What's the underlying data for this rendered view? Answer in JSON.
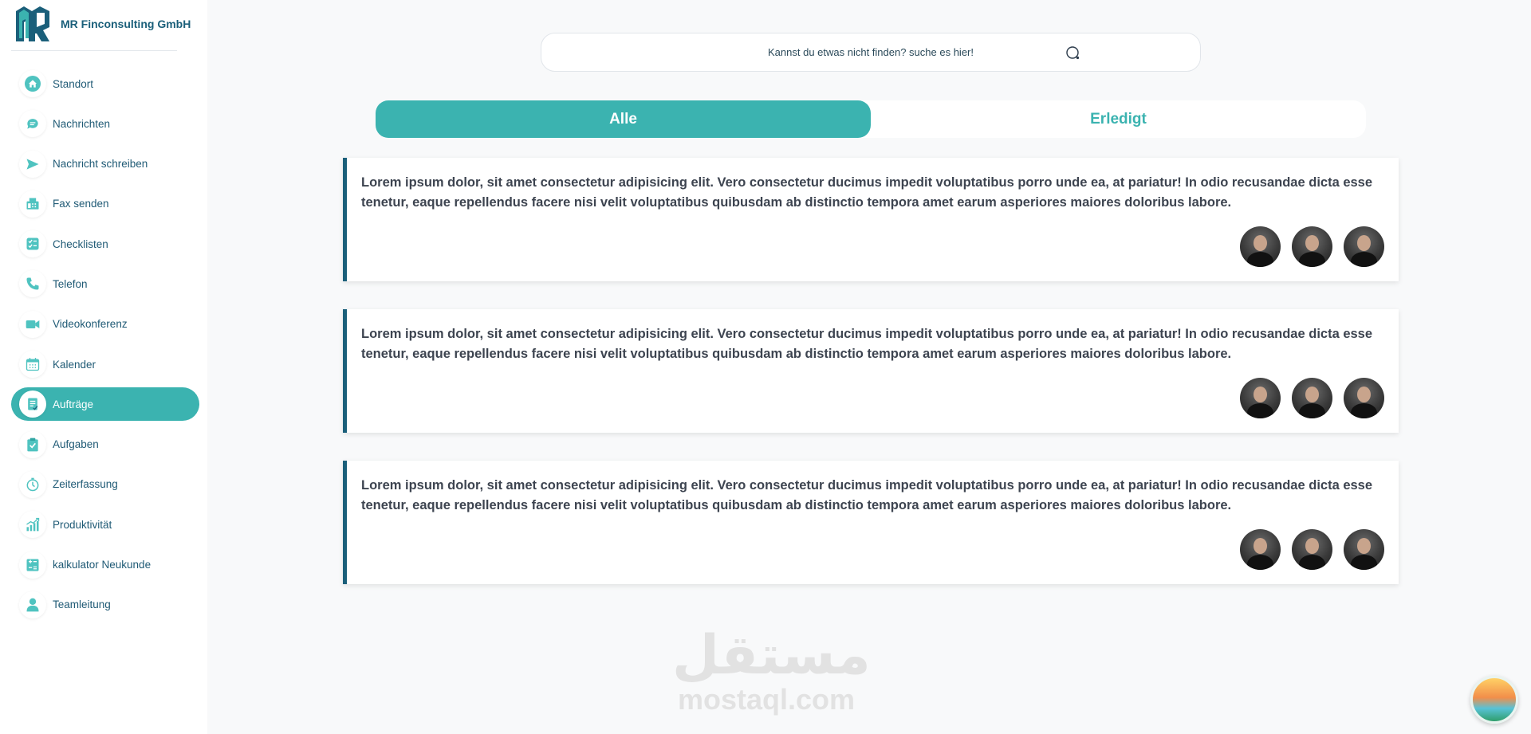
{
  "brand": {
    "name": "MR Finconsulting GmbH"
  },
  "nav": [
    {
      "label": "Standort",
      "icon": "home-icon"
    },
    {
      "label": "Nachrichten",
      "icon": "chat-icon"
    },
    {
      "label": "Nachricht schreiben",
      "icon": "send-icon"
    },
    {
      "label": "Fax senden",
      "icon": "fax-icon"
    },
    {
      "label": "Checklisten",
      "icon": "checklist-icon"
    },
    {
      "label": "Telefon",
      "icon": "phone-icon"
    },
    {
      "label": "Videokonferenz",
      "icon": "video-icon"
    },
    {
      "label": "Kalender",
      "icon": "calendar-icon"
    },
    {
      "label": "Aufträge",
      "icon": "orders-icon",
      "active": true
    },
    {
      "label": "Aufgaben",
      "icon": "clipboard-check-icon"
    },
    {
      "label": "Zeiterfassung",
      "icon": "stopwatch-icon"
    },
    {
      "label": "Produktivität",
      "icon": "chart-icon"
    },
    {
      "label": "kalkulator Neukunde",
      "icon": "calculator-icon"
    },
    {
      "label": "Teamleitung",
      "icon": "user-icon"
    }
  ],
  "search": {
    "placeholder": "Kannst du etwas nicht finden? suche es hier!"
  },
  "tabs": [
    {
      "label": "Alle",
      "active": true
    },
    {
      "label": "Erledigt",
      "active": false
    }
  ],
  "cards": [
    {
      "text": "Lorem ipsum dolor, sit amet consectetur adipisicing elit. Vero consectetur ducimus impedit voluptatibus porro unde ea, at pariatur! In odio recusandae dicta esse tenetur, eaque repellendus facere nisi velit voluptatibus quibusdam ab distinctio tempora amet earum asperiores maiores doloribus labore."
    },
    {
      "text": "Lorem ipsum dolor, sit amet consectetur adipisicing elit. Vero consectetur ducimus impedit voluptatibus porro unde ea, at pariatur! In odio recusandae dicta esse tenetur, eaque repellendus facere nisi velit voluptatibus quibusdam ab distinctio tempora amet earum asperiores maiores doloribus labore."
    },
    {
      "text": "Lorem ipsum dolor, sit amet consectetur adipisicing elit. Vero consectetur ducimus impedit voluptatibus porro unde ea, at pariatur! In odio recusandae dicta esse tenetur, eaque repellendus facere nisi velit voluptatibus quibusdam ab distinctio tempora amet earum asperiores maiores doloribus labore."
    }
  ],
  "watermark": {
    "arabic": "مستقل",
    "latin": "mostaql.com"
  },
  "colors": {
    "accent": "#3bb3b0",
    "brand": "#1a5f7a"
  }
}
